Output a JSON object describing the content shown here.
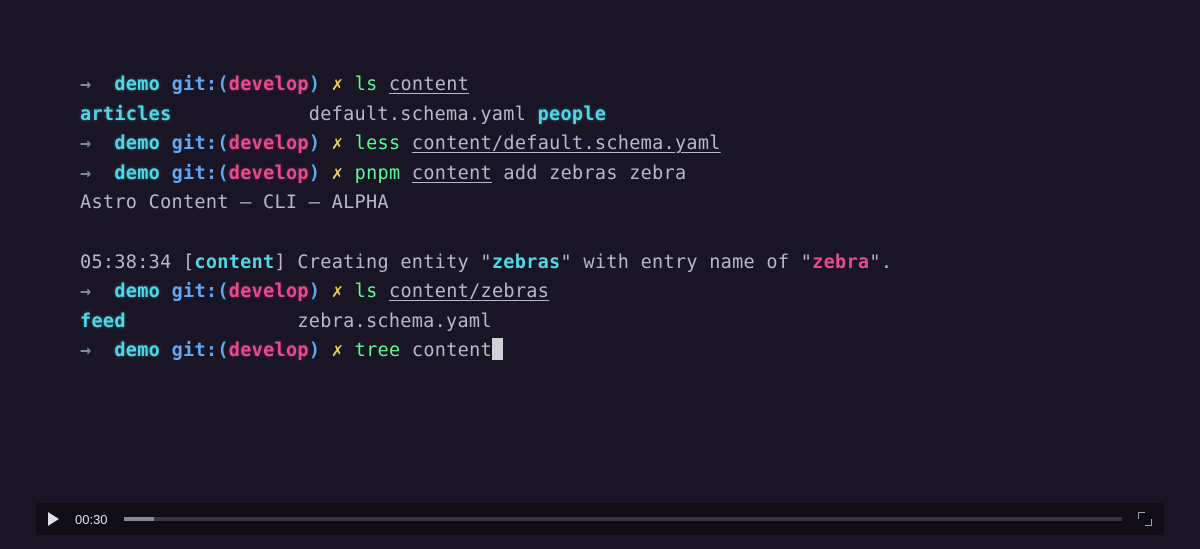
{
  "prompt": {
    "arrow": "→",
    "folder": "demo",
    "git_label": "git:",
    "paren_open": "(",
    "branch": "develop",
    "paren_close": ")",
    "dirty": "✗"
  },
  "lines": {
    "l1": {
      "cmd": "ls",
      "arg": "content"
    },
    "l2": {
      "col1": "articles",
      "col2": "default.schema.yaml",
      "col3": "people"
    },
    "l3": {
      "cmd": "less",
      "arg": "content/default.schema.yaml"
    },
    "l4": {
      "cmd": "pnpm",
      "arg_u": "content",
      "arg_rest": " add zebras zebra"
    },
    "l5": {
      "text": "Astro Content — CLI — ALPHA"
    },
    "l6": {
      "time": "05:38:34 ",
      "lb": "[",
      "tag": "content",
      "rb": "]",
      "text1": " Creating entity ",
      "q": "\"",
      "zebras": "zebras",
      "text2": " with entry name of ",
      "zebra": "zebra",
      "dot": "."
    },
    "l7": {
      "cmd": "ls",
      "arg": "content/zebras"
    },
    "l8": {
      "col1": "feed",
      "col2": "zebra.schema.yaml"
    },
    "l9": {
      "cmd": "tree",
      "arg": " content"
    }
  },
  "video": {
    "time": "00:30"
  }
}
